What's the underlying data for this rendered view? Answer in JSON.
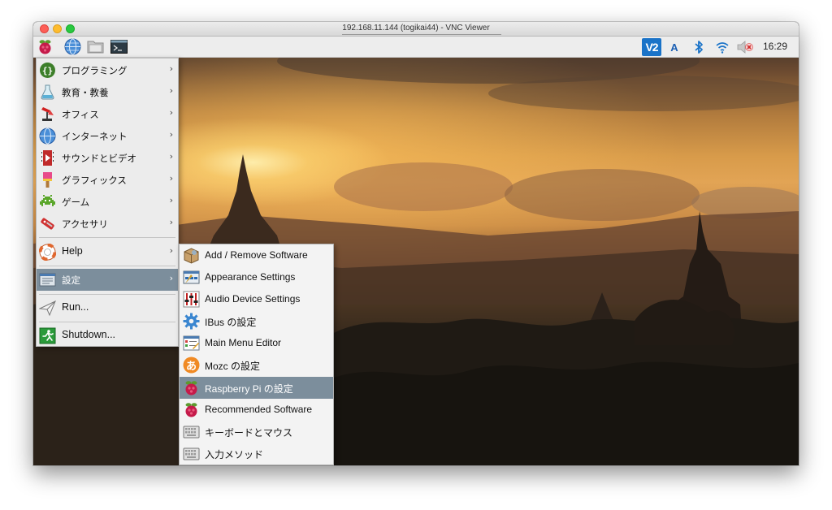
{
  "window": {
    "title": "192.168.11.144 (togikai44) - VNC Viewer"
  },
  "colors": {
    "menu_selected": "#7c8e9c",
    "panel_bg": "#ededed",
    "vnc_blue": "#1a73c8"
  },
  "panel": {
    "launchers": [
      {
        "name": "raspberry-menu-icon"
      },
      {
        "name": "web-browser-icon"
      },
      {
        "name": "file-manager-icon"
      },
      {
        "name": "terminal-icon"
      }
    ],
    "tray": {
      "vnc_icon_text": "V2",
      "input_method": "A",
      "clock": "16:29"
    }
  },
  "main_menu": {
    "items": [
      {
        "label": "プログラミング",
        "arrow": "›",
        "icon": "programming-icon"
      },
      {
        "label": "教育・教養",
        "arrow": "›",
        "icon": "education-icon"
      },
      {
        "label": "オフィス",
        "arrow": "›",
        "icon": "office-icon"
      },
      {
        "label": "インターネット",
        "arrow": "›",
        "icon": "internet-icon"
      },
      {
        "label": "サウンドとビデオ",
        "arrow": "›",
        "icon": "sound-video-icon"
      },
      {
        "label": "グラフィックス",
        "arrow": "›",
        "icon": "graphics-icon"
      },
      {
        "label": "ゲーム",
        "arrow": "›",
        "icon": "games-icon"
      },
      {
        "label": "アクセサリ",
        "arrow": "›",
        "icon": "accessories-icon"
      },
      {
        "label": "Help",
        "arrow": "›",
        "icon": "help-icon"
      },
      {
        "label": "設定",
        "arrow": "›",
        "icon": "settings-icon",
        "selected": true
      },
      {
        "label": "Run...",
        "icon": "run-icon"
      },
      {
        "label": "Shutdown...",
        "icon": "shutdown-icon"
      }
    ]
  },
  "settings_submenu": {
    "items": [
      {
        "label": "Add / Remove Software",
        "icon": "package-icon"
      },
      {
        "label": "Appearance Settings",
        "icon": "appearance-icon"
      },
      {
        "label": "Audio Device Settings",
        "icon": "audio-mixer-icon"
      },
      {
        "label": "IBus の設定",
        "icon": "gear-icon"
      },
      {
        "label": "Main Menu Editor",
        "icon": "menu-editor-icon"
      },
      {
        "label": "Mozc の設定",
        "icon": "mozc-icon",
        "icon_text": "あ"
      },
      {
        "label": "Raspberry Pi の設定",
        "icon": "raspberry-icon",
        "selected": true
      },
      {
        "label": "Recommended Software",
        "icon": "raspberry-icon"
      },
      {
        "label": "キーボードとマウス",
        "icon": "keyboard-icon"
      },
      {
        "label": "入力メソッド",
        "icon": "keyboard-icon"
      }
    ]
  }
}
